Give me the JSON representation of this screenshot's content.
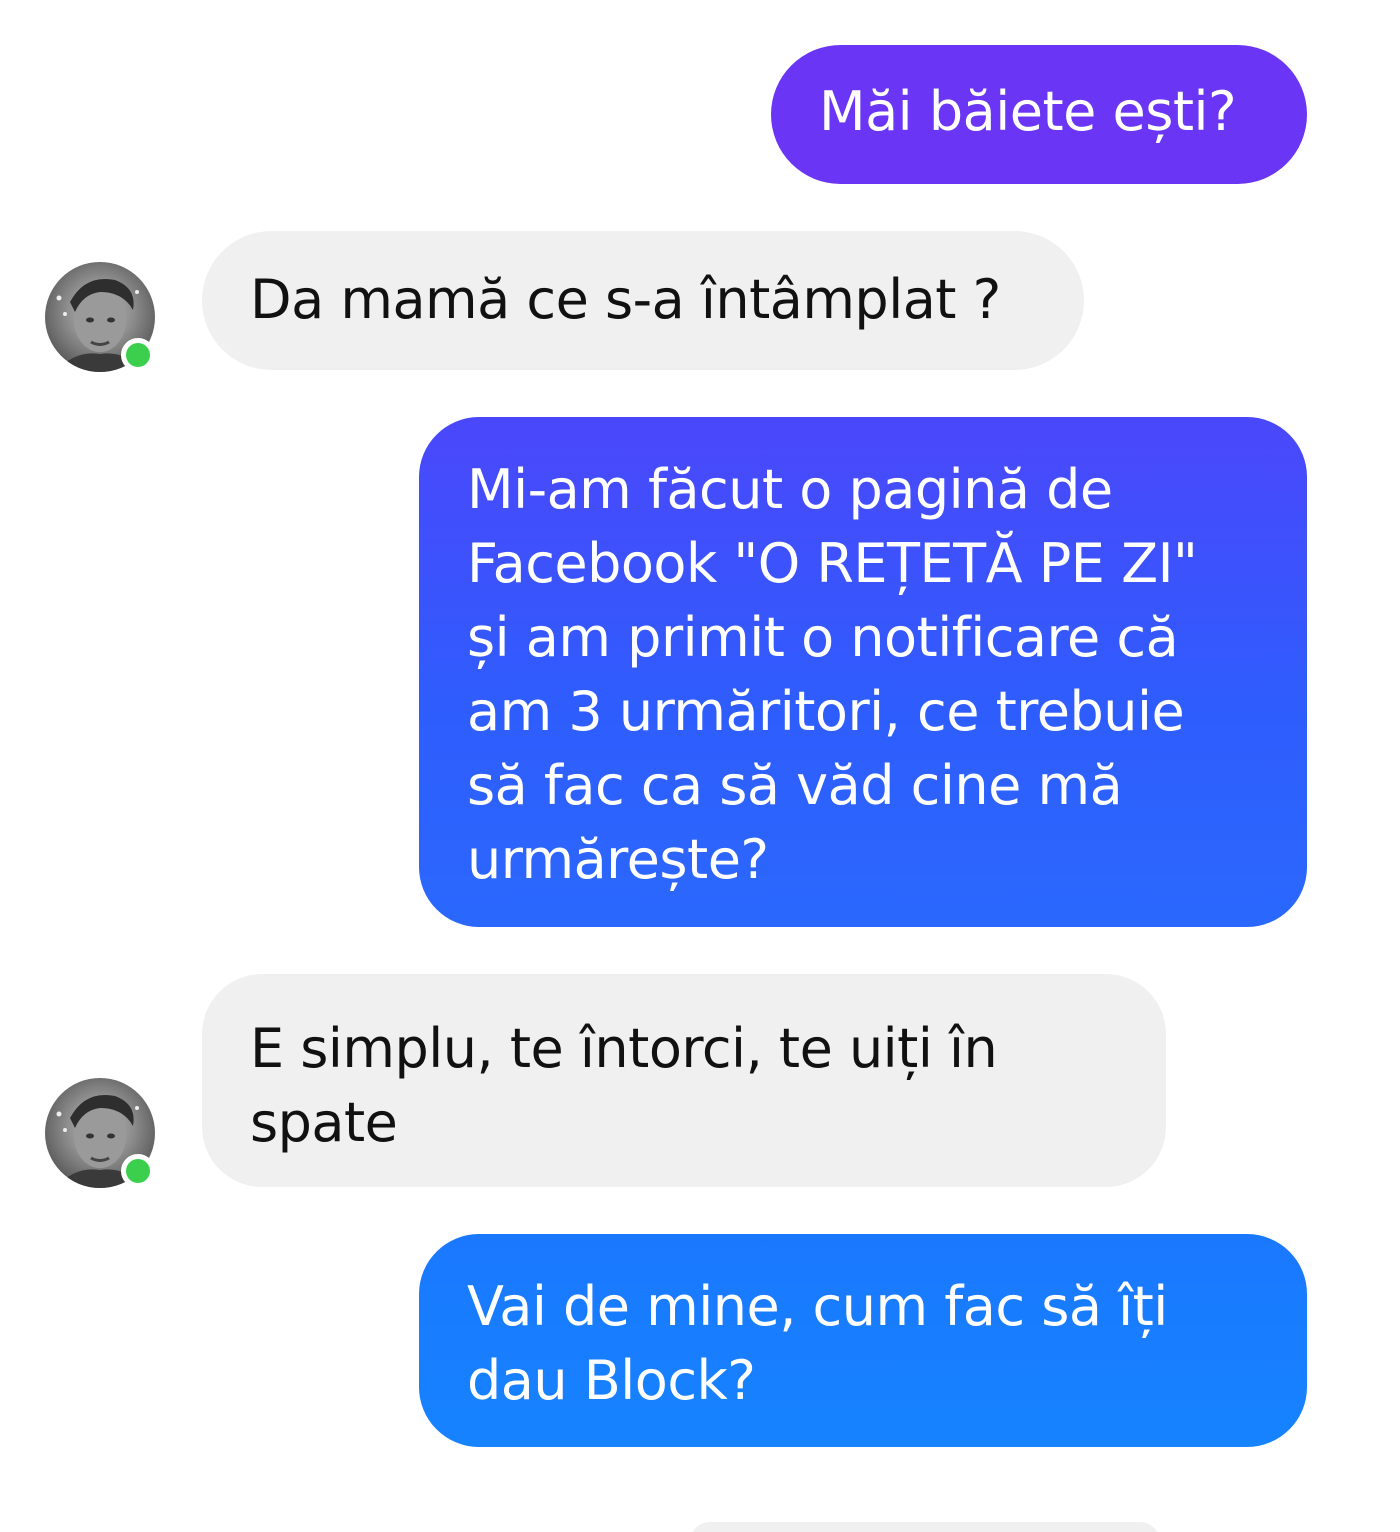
{
  "messages": [
    {
      "direction": "outgoing",
      "lines": [
        "Măi băiete ești?"
      ]
    },
    {
      "direction": "incoming",
      "lines": [
        "Da mamă ce s-a întâmplat ?"
      ]
    },
    {
      "direction": "outgoing",
      "lines": [
        "Mi-am făcut o pagină de",
        "Facebook \"O REȚETĂ PE ZI\"",
        "și am primit o notificare că",
        "am 3 urmăritori,  ce trebuie",
        "să fac ca să văd cine mă",
        "urmărește?"
      ]
    },
    {
      "direction": "incoming",
      "lines": [
        "E simplu,  te întorci, te uiți în",
        "spate"
      ]
    },
    {
      "direction": "outgoing",
      "lines": [
        "Vai de mine,  cum fac să îți",
        "dau Block?"
      ]
    }
  ],
  "contact": {
    "status": "online"
  },
  "colors": {
    "outgoing_top": "#6a35f5",
    "outgoing_mid": "#2f5cfd",
    "outgoing_bottom": "#1683ff",
    "incoming_bg": "#f0f0f0",
    "online_dot": "#3ccf4e"
  }
}
